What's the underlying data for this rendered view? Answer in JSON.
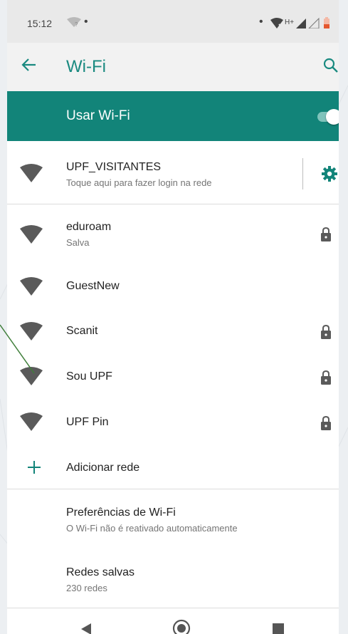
{
  "status_bar": {
    "time": "15:12",
    "left_signal_icon": "wifi-question-icon",
    "right_icons": [
      "wifi-x-icon",
      "hplus-signal-icon",
      "battery-low-icon"
    ],
    "network_type": "H+"
  },
  "app_bar": {
    "title": "Wi-Fi"
  },
  "wifi_toggle": {
    "label": "Usar Wi-Fi",
    "enabled": true
  },
  "connected": {
    "name": "UPF_VISITANTES",
    "status": "Toque aqui para fazer login na rede"
  },
  "networks": [
    {
      "name": "eduroam",
      "sub": "Salva",
      "locked": true
    },
    {
      "name": "GuestNew",
      "sub": "",
      "locked": false
    },
    {
      "name": "Scanit",
      "sub": "",
      "locked": true
    },
    {
      "name": "Sou UPF",
      "sub": "",
      "locked": true
    },
    {
      "name": "UPF Pin",
      "sub": "",
      "locked": true
    }
  ],
  "add_network": {
    "label": "Adicionar rede"
  },
  "preferences": {
    "title": "Preferências de Wi-Fi",
    "sub": "O Wi-Fi não é reativado automaticamente"
  },
  "saved": {
    "title": "Redes salvas",
    "sub": "230 redes"
  },
  "colors": {
    "accent": "#128479",
    "title": "#1a8a80",
    "icon": "#5a5a5a"
  }
}
